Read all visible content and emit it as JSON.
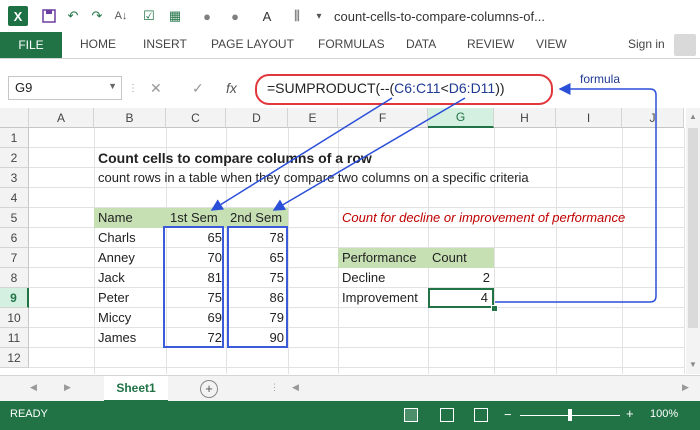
{
  "window": {
    "title": "count-cells-to-compare-columns-of...",
    "app_letter": "X"
  },
  "ribbon": {
    "file_label": "FILE",
    "tabs": [
      "HOME",
      "INSERT",
      "PAGE LAYOUT",
      "FORMULAS",
      "DATA",
      "REVIEW",
      "VIEW"
    ],
    "signin": "Sign in"
  },
  "formula_bar": {
    "name_box": "G9",
    "fx": "fx",
    "formula_prefix": "=SUMPRODUCT(--(",
    "range1": "C6:C11",
    "op": "<",
    "range2": "D6:D11",
    "formula_suffix": "))",
    "annotation": "formula"
  },
  "columns": [
    "A",
    "B",
    "C",
    "D",
    "E",
    "F",
    "G",
    "H",
    "I",
    "J"
  ],
  "selected_column": "G",
  "rows": [
    "1",
    "2",
    "3",
    "4",
    "5",
    "6",
    "7",
    "8",
    "9",
    "10",
    "11",
    "12"
  ],
  "selected_row": "9",
  "sheet": {
    "title": "Count cells to compare columns of  a row",
    "subtitle": "count rows in a table when they compare two columns on a specific criteria",
    "headers": [
      "Name",
      "1st Sem",
      "2nd Sem"
    ],
    "data": [
      {
        "name": "Charls",
        "sem1": "65",
        "sem2": "78"
      },
      {
        "name": "Anney",
        "sem1": "70",
        "sem2": "65"
      },
      {
        "name": "Jack",
        "sem1": "81",
        "sem2": "75"
      },
      {
        "name": "Peter",
        "sem1": "75",
        "sem2": "86"
      },
      {
        "name": "Miccy",
        "sem1": "69",
        "sem2": "79"
      },
      {
        "name": "James",
        "sem1": "72",
        "sem2": "90"
      }
    ],
    "note": "Count for decline or improvement of performance",
    "perf_headers": [
      "Performance",
      "Count"
    ],
    "perf": [
      {
        "label": "Decline",
        "count": "2"
      },
      {
        "label": "Improvement",
        "count": "4"
      }
    ]
  },
  "sheet_tabs": {
    "active": "Sheet1",
    "add": "+"
  },
  "status": {
    "ready": "READY",
    "zoom": "100%"
  },
  "colors": {
    "excel_green": "#217346",
    "header_fill": "#c6e0b4",
    "note_red": "#c00000",
    "annotation_blue": "#2b4fd9",
    "formula_oval": "#e1363b"
  }
}
